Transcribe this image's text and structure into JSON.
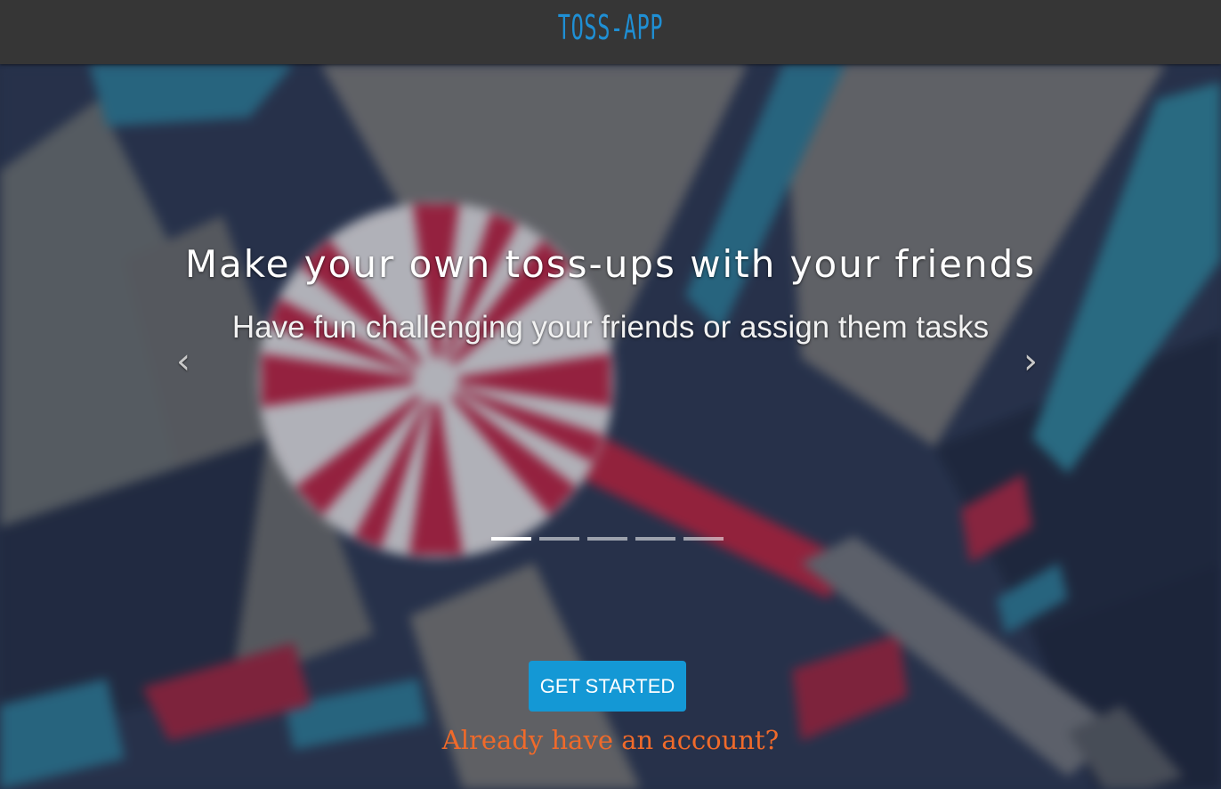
{
  "navbar": {
    "logo_text": "TOSS-APP"
  },
  "hero": {
    "headline": "Make your own toss-ups with your friends",
    "subline": "Have fun challenging your friends or assign them tasks",
    "prev_arrow": "‹",
    "next_arrow": "›",
    "indicators": {
      "count": 5,
      "active_index": 0
    },
    "cta_label": "GET STARTED",
    "signin_link": "Already have an account?"
  },
  "colors": {
    "navbar_bg": "#363636",
    "logo": "#1f8fd4",
    "cta_bg": "#1498d5",
    "signin_link": "#f06a2a"
  }
}
